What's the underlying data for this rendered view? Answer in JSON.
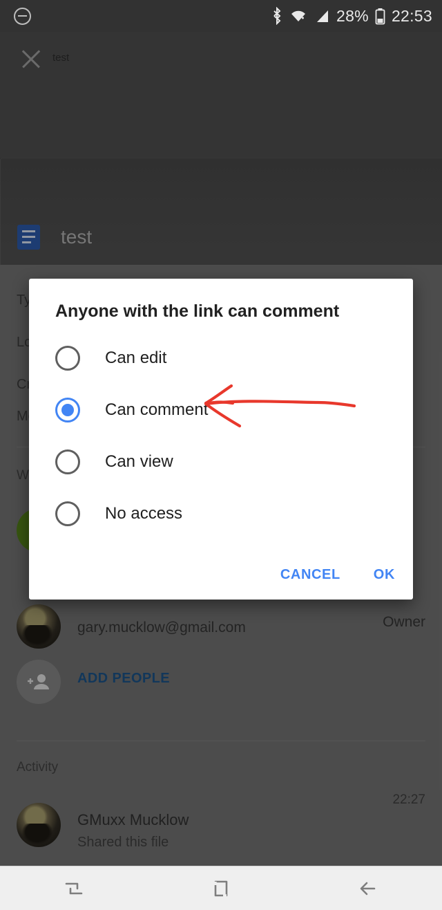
{
  "status_bar": {
    "dnd_icon": "do-not-disturb-icon",
    "bluetooth_icon": "bluetooth-icon",
    "wifi_icon": "wifi-icon",
    "signal_icon": "cellular-signal-icon",
    "battery_percent": "28%",
    "battery_icon": "battery-icon",
    "clock": "22:53"
  },
  "app_header": {
    "close_icon": "close-icon",
    "mini_title": "test",
    "doc_icon": "google-docs-icon",
    "file_title": "test"
  },
  "details": {
    "meta_rows": [
      {
        "label": "Type"
      },
      {
        "label": "Location"
      },
      {
        "label": "Created"
      },
      {
        "label": "Modified"
      }
    ],
    "who_has_access_label": "Who has access",
    "owner": {
      "email": "gary.mucklow@gmail.com",
      "role": "Owner",
      "avatar": "user-avatar"
    },
    "add_people": {
      "label": "ADD PEOPLE",
      "icon": "person-add-icon"
    },
    "activity": {
      "section_label": "Activity",
      "items": [
        {
          "name": "GMuxx Mucklow",
          "action": "Shared this file",
          "time": "22:27",
          "avatar": "user-avatar"
        }
      ]
    }
  },
  "dialog": {
    "title": "Anyone with the link can comment",
    "options": [
      {
        "label": "Can edit",
        "selected": false
      },
      {
        "label": "Can comment",
        "selected": true
      },
      {
        "label": "Can view",
        "selected": false
      },
      {
        "label": "No access",
        "selected": false
      }
    ],
    "cancel_label": "CANCEL",
    "ok_label": "OK",
    "accent_color": "#4285f4"
  },
  "annotation": {
    "type": "hand-drawn-arrow",
    "color": "#e8382c",
    "points_to": "Can comment"
  },
  "nav_bar": {
    "recents_icon": "recents-icon",
    "home_icon": "home-icon",
    "back_icon": "back-icon"
  }
}
